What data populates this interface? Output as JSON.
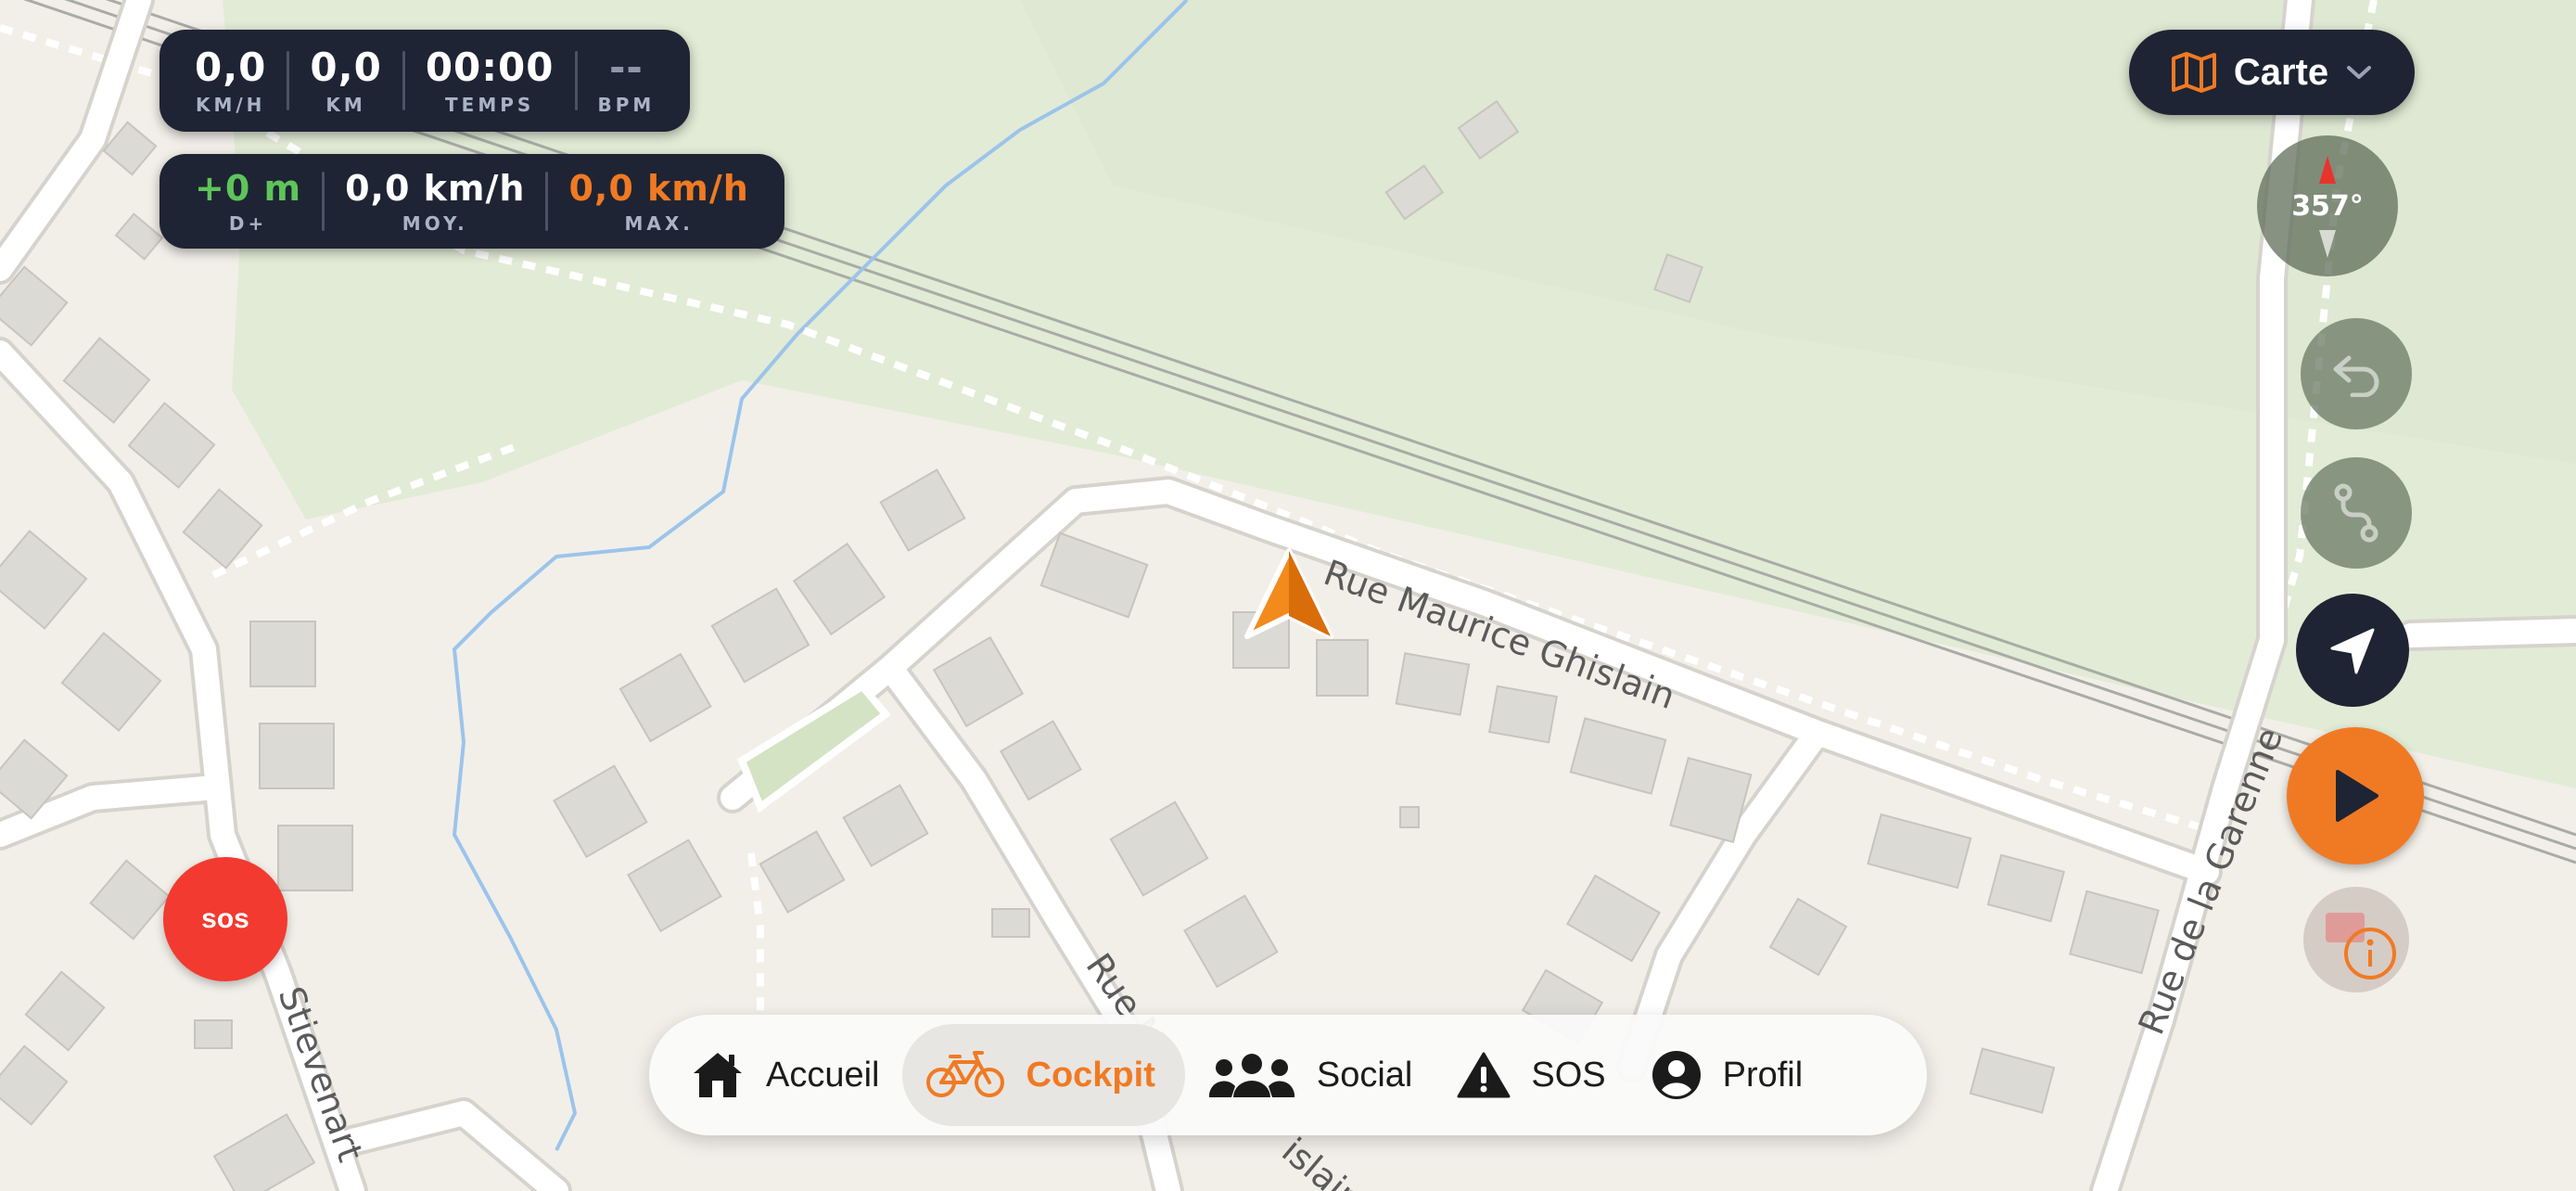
{
  "stats_top": [
    {
      "value": "0,0",
      "unit": "KM/H"
    },
    {
      "value": "0,0",
      "unit": "KM"
    },
    {
      "value": "00:00",
      "unit": "TEMPS"
    },
    {
      "value": "--",
      "unit": "BPM"
    }
  ],
  "stats_bottom": {
    "elevation": {
      "value": "+0 m",
      "unit": "D+"
    },
    "average": {
      "value": "0,0 km/h",
      "unit": "MOY."
    },
    "max": {
      "value": "0,0 km/h",
      "unit": "MAX."
    }
  },
  "map_style_selector": {
    "label": "Carte",
    "icon": "map-icon"
  },
  "compass": {
    "heading": "357°"
  },
  "map": {
    "street_labels": [
      "Rue Maurice Ghislain",
      "Rue de la Garenne",
      "Rue M",
      "Stievenart",
      "islain"
    ]
  },
  "sos_floating": {
    "label": "sos"
  },
  "bottom_nav": {
    "items": [
      {
        "label": "Accueil",
        "icon": "home-icon"
      },
      {
        "label": "Cockpit",
        "icon": "bicycle-icon",
        "active": true
      },
      {
        "label": "Social",
        "icon": "group-icon"
      },
      {
        "label": "SOS",
        "icon": "warning-icon"
      },
      {
        "label": "Profil",
        "icon": "profile-icon"
      }
    ]
  },
  "colors": {
    "accent": "#f07a23",
    "panel": "#1e2433",
    "sos": "#f23a30",
    "positive": "#5fc45a"
  }
}
